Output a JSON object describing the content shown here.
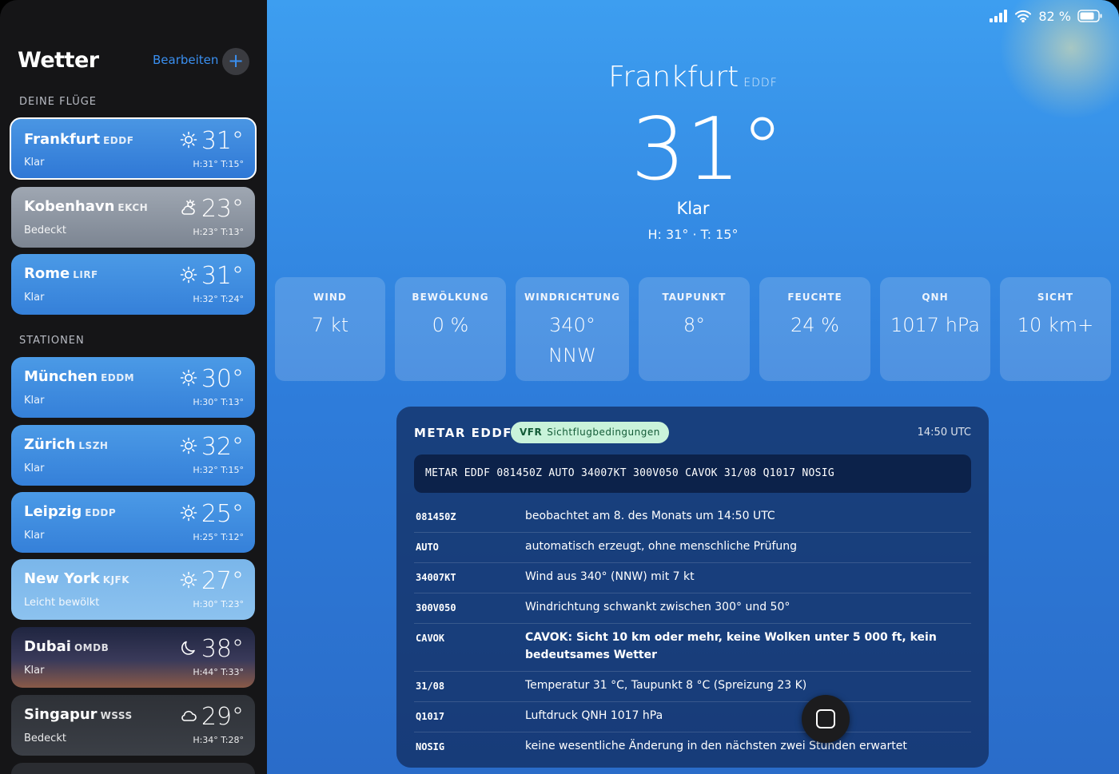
{
  "sidebar": {
    "title": "Wetter",
    "edit_label": "Bearbeiten",
    "add_icon": "plus-icon",
    "sections": {
      "flights": "DEINE FLÜGE",
      "stations": "STATIONEN"
    },
    "flights": [
      {
        "name": "Frankfurt",
        "code": "EDDF",
        "condition": "Klar",
        "temp": "31°",
        "hl": "H:31° T:15°",
        "icon": "sun-icon",
        "selected": true
      }
    ],
    "flights_more": [
      {
        "name": "Kobenhavn",
        "code": "EKCH",
        "condition": "Bedeckt",
        "temp": "23°",
        "hl": "H:23° T:13°",
        "icon": "cloud-sun-icon"
      },
      {
        "name": "Rome",
        "code": "LIRF",
        "condition": "Klar",
        "temp": "31°",
        "hl": "H:32° T:24°",
        "icon": "sun-icon"
      }
    ],
    "stations": [
      {
        "name": "München",
        "code": "EDDM",
        "condition": "Klar",
        "temp": "30°",
        "hl": "H:30° T:13°",
        "icon": "sun-icon"
      },
      {
        "name": "Zürich",
        "code": "LSZH",
        "condition": "Klar",
        "temp": "32°",
        "hl": "H:32° T:15°",
        "icon": "sun-icon"
      },
      {
        "name": "Leipzig",
        "code": "EDDP",
        "condition": "Klar",
        "temp": "25°",
        "hl": "H:25° T:12°",
        "icon": "sun-icon"
      },
      {
        "name": "New York",
        "code": "KJFK",
        "condition": "Leicht bewölkt",
        "temp": "27°",
        "hl": "H:30° T:23°",
        "icon": "sun-icon"
      },
      {
        "name": "Dubai",
        "code": "OMDB",
        "condition": "Klar",
        "temp": "38°",
        "hl": "H:44° T:33°",
        "icon": "moon-icon"
      },
      {
        "name": "Singapur",
        "code": "WSSS",
        "condition": "Bedeckt",
        "temp": "29°",
        "hl": "H:34° T:28°",
        "icon": "cloud-icon"
      }
    ]
  },
  "status": {
    "battery": "82 %"
  },
  "hero": {
    "city": "Frankfurt",
    "code": "EDDF",
    "temp": "31°",
    "condition": "Klar",
    "hl": "H: 31° · T: 15°"
  },
  "tiles": [
    {
      "label": "WIND",
      "value": "7 kt",
      "sub": ""
    },
    {
      "label": "BEWÖLKUNG",
      "value": "0 %",
      "sub": ""
    },
    {
      "label": "WINDRICHTUNG",
      "value": "340°",
      "sub": "NNW"
    },
    {
      "label": "TAUPUNKT",
      "value": "8°",
      "sub": ""
    },
    {
      "label": "FEUCHTE",
      "value": "24 %",
      "sub": ""
    },
    {
      "label": "QNH",
      "value": "1017 hPa",
      "sub": ""
    },
    {
      "label": "SICHT",
      "value": "10 km+",
      "sub": ""
    }
  ],
  "metar": {
    "title": "METAR EDDF",
    "badge_code": "VFR",
    "badge_text": "Sichtflugbedingungen",
    "time": "14:50 UTC",
    "raw": "METAR EDDF 081450Z AUTO 34007KT 300V050 CAVOK 31/08 Q1017 NOSIG",
    "rows": [
      {
        "code": "081450Z",
        "desc": "beobachtet am 8. des Monats um 14:50 UTC"
      },
      {
        "code": "AUTO",
        "desc": "automatisch erzeugt, ohne menschliche Prüfung"
      },
      {
        "code": "34007KT",
        "desc": "Wind aus 340° (NNW) mit 7 kt"
      },
      {
        "code": "300V050",
        "desc": "Windrichtung schwankt zwischen 300° und 50°"
      },
      {
        "code": "CAVOK",
        "desc": "CAVOK: Sicht 10 km oder mehr, keine Wolken unter 5 000 ft, kein bedeutsames Wetter"
      },
      {
        "code": "31/08",
        "desc": "Temperatur 31 °C, Taupunkt 8 °C (Spreizung 23 K)"
      },
      {
        "code": "Q1017",
        "desc": "Luftdruck QNH 1017 hPa"
      },
      {
        "code": "NOSIG",
        "desc": "keine wesentliche Änderung in den nächsten zwei Stunden erwartet"
      }
    ]
  }
}
